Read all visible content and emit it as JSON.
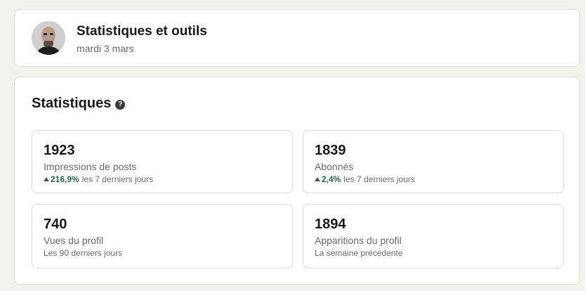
{
  "header": {
    "title": "Statistiques et outils",
    "date": "mardi 3 mars"
  },
  "stats": {
    "title": "Statistiques",
    "help_icon": "?",
    "items": [
      {
        "value": "1923",
        "label": "Impressions de posts",
        "trend": "216,9%",
        "period": "les 7 derniers jours"
      },
      {
        "value": "1839",
        "label": "Abonnés",
        "trend": "2,4%",
        "period": "les 7 derniers jours"
      },
      {
        "value": "740",
        "label": "Vues du profil",
        "period": "Les 90 derniers jours"
      },
      {
        "value": "1894",
        "label": "Apparitions du profil",
        "period": "La semaine précédente"
      }
    ]
  },
  "colors": {
    "background": "#f3f2ef",
    "trend_positive": "#1f6b45"
  }
}
